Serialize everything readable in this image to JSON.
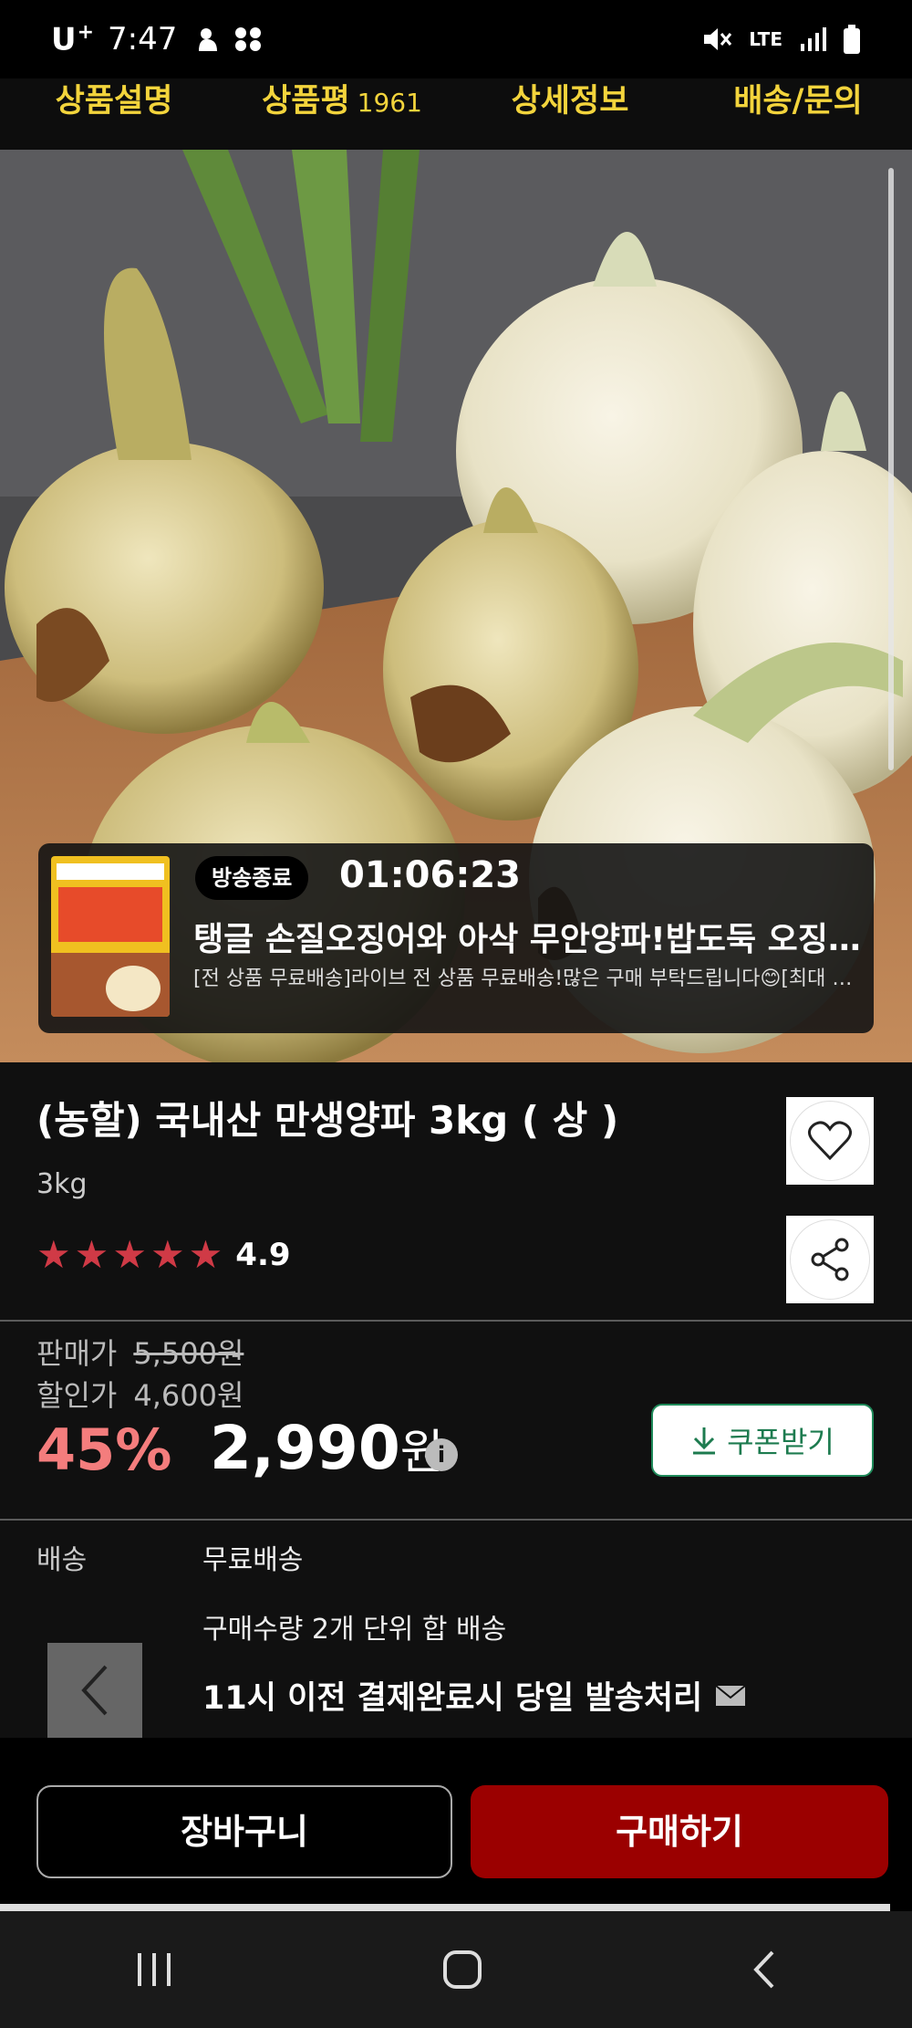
{
  "status_bar": {
    "carrier": "U",
    "carrier_sup": "+",
    "time": "7:47",
    "network": "LTE"
  },
  "tabs": [
    {
      "label": "상품설명",
      "count": ""
    },
    {
      "label": "상품평",
      "count": "1961"
    },
    {
      "label": "상세정보",
      "count": ""
    },
    {
      "label": "배송/문의",
      "count": ""
    }
  ],
  "live": {
    "badge": "방송종료",
    "timer": "01:06:23",
    "title": "탱글 손질오징어와 아삭 무안양파!밥도둑 오징어볶음 레시피까지!",
    "description": "[전 상품 무료배송]라이브 전 상품 무료배송!많은 구매 부탁드립니다😊[최대 할인 쿠폰]"
  },
  "product": {
    "title": "(농할) 국내산 만생양파 3kg ( 상 )",
    "option": "3kg",
    "rating": "4.9",
    "stars": 5
  },
  "price": {
    "sale_label": "판매가",
    "sale_value": "5,500원",
    "discount_label": "할인가",
    "discount_value": "4,600원",
    "rate": "45%",
    "final_number": "2,990",
    "final_unit": "원",
    "coupon_label": "쿠폰받기"
  },
  "shipping": {
    "label": "배송",
    "line1": "무료배송",
    "line2": "구매수량 2개 단위 합 배송",
    "line3": "11시 이전 결제완료시 당일 발송처리"
  },
  "actions": {
    "cart": "장바구니",
    "buy": "구매하기"
  },
  "colors": {
    "tab_text": "#f3d43c",
    "tab_indicator": "#ef5b5b",
    "star": "#d03a46",
    "discount_rate": "#f47d7d",
    "buy_button": "#9b0000",
    "coupon_border": "#1f8a5a"
  }
}
